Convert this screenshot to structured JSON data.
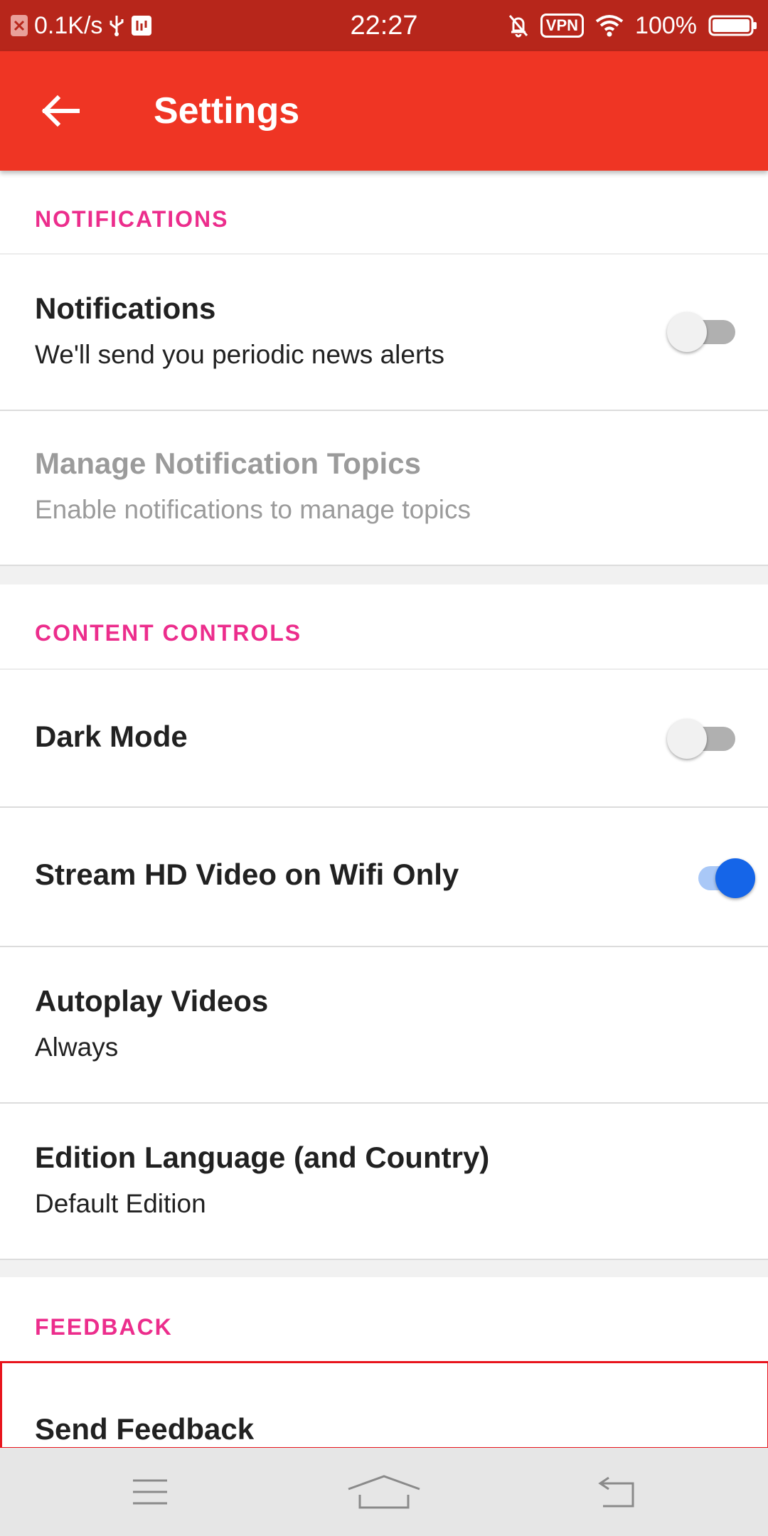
{
  "status_bar": {
    "net_speed": "0.1K/s",
    "time": "22:27",
    "vpn": "VPN",
    "battery": "100%"
  },
  "app_bar": {
    "title": "Settings",
    "color": "#ef3524"
  },
  "sections": {
    "notifications": {
      "header": "NOTIFICATIONS",
      "items": [
        {
          "title": "Notifications",
          "subtitle": "We'll send you periodic news alerts",
          "toggle": false
        },
        {
          "title": "Manage Notification Topics",
          "subtitle": "Enable notifications to manage topics",
          "disabled": true
        }
      ]
    },
    "content_controls": {
      "header": "CONTENT CONTROLS",
      "items": [
        {
          "title": "Dark Mode",
          "toggle": false
        },
        {
          "title": "Stream HD Video on Wifi Only",
          "toggle": true
        },
        {
          "title": "Autoplay Videos",
          "subtitle": "Always"
        },
        {
          "title": "Edition Language (and Country)",
          "subtitle": "Default Edition"
        }
      ]
    },
    "feedback": {
      "header": "FEEDBACK",
      "items": [
        {
          "title": "Send Feedback"
        }
      ]
    }
  },
  "nav_bar": {
    "buttons": [
      "menu-icon",
      "home-icon",
      "back-icon"
    ]
  },
  "colors": {
    "status_bar": "#b7261b",
    "accent": "#ec2d8c",
    "toggle_on": "#1565e8",
    "highlight": "#e8141c"
  }
}
